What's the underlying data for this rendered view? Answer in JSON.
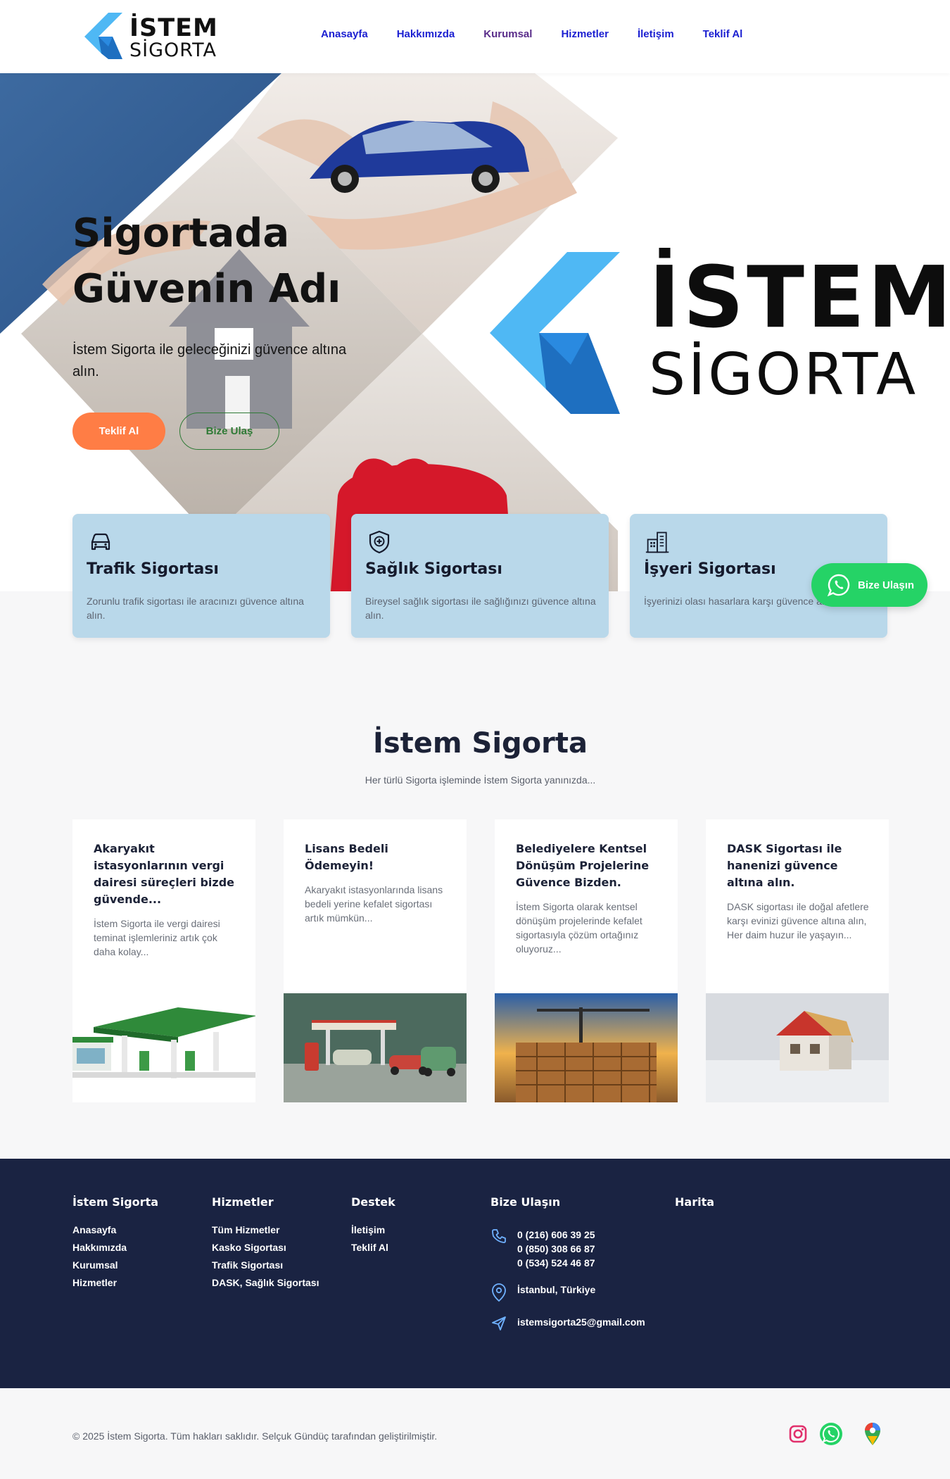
{
  "brand": {
    "name_line1": "İSTEM",
    "name_line2": "SİGORTA",
    "colors": {
      "accent_light": "#4fb8f4",
      "accent_dark": "#1e6fc0",
      "orange": "#ff7d45",
      "navy": "#1a2342",
      "card_blue": "#b9d8ea",
      "whatsapp": "#25d366"
    }
  },
  "nav": {
    "items": [
      {
        "label": "Anasayfa"
      },
      {
        "label": "Hakkımızda"
      },
      {
        "label": "Kurumsal"
      },
      {
        "label": "Hizmetler"
      },
      {
        "label": "İletişim"
      },
      {
        "label": "Teklif Al"
      }
    ]
  },
  "hero": {
    "title_line1": "Sigortada",
    "title_line2": "Güvenin Adı",
    "subtitle": "İstem Sigorta ile geleceğinizi güvence altına alın.",
    "primary_button": "Teklif Al",
    "secondary_button": "Bize Ulaş",
    "big_logo_line1": "İSTEM",
    "big_logo_line2": "SİGORTA"
  },
  "services": [
    {
      "icon": "car-icon",
      "title": "Trafik Sigortası",
      "desc": "Zorunlu trafik sigortası ile aracınızı güvence altına alın."
    },
    {
      "icon": "shield-health-icon",
      "title": "Sağlık Sigortası",
      "desc": "Bireysel sağlık sigortası ile sağlığınızı güvence altına alın."
    },
    {
      "icon": "building-icon",
      "title": "İşyeri Sigortası",
      "desc": "İşyerinizi olası hasarlara karşı güvence altına alın."
    }
  ],
  "whatsapp_float": {
    "label": "Bize Ulaşın",
    "icon": "whatsapp-icon"
  },
  "section": {
    "title": "İstem Sigorta",
    "subtitle": "Her türlü Sigorta işleminde İstem Sigorta yanınızda..."
  },
  "posts": [
    {
      "title": "Akaryakıt istasyonlarının vergi dairesi süreçleri bizde güvende...",
      "excerpt": "İstem Sigorta ile vergi dairesi teminat işlemleriniz artık çok daha kolay...",
      "image": "gas-station-illustration"
    },
    {
      "title": "Lisans Bedeli Ödemeyin!",
      "excerpt": "Akaryakıt istasyonlarında lisans bedeli yerine kefalet sigortası artık mümkün...",
      "image": "retro-gas-station-illustration"
    },
    {
      "title": "Belediyelere Kentsel Dönüşüm Projelerine Güvence Bizden.",
      "excerpt": "İstem Sigorta olarak kentsel dönüşüm projelerinde kefalet sigortasıyla çözüm ortağınız oluyoruz...",
      "image": "construction-site-photo"
    },
    {
      "title": "DASK Sigortası ile hanenizi güvence altına alın.",
      "excerpt": "DASK sigortası ile doğal afetlere karşı evinizi güvence altına alın, Her daim huzur ile yaşayın...",
      "image": "house-model-photo"
    }
  ],
  "footer": {
    "col1": {
      "title": "İstem Sigorta",
      "links": [
        "Anasayfa",
        "Hakkımızda",
        "Kurumsal",
        "Hizmetler"
      ]
    },
    "col2": {
      "title": "Hizmetler",
      "links": [
        "Tüm Hizmetler",
        "Kasko Sigortası",
        "Trafik Sigortası",
        "DASK, Sağlık Sigortası"
      ]
    },
    "col3": {
      "title": "Destek",
      "links": [
        "İletişim",
        "Teklif Al"
      ]
    },
    "col4": {
      "title": "Bize Ulaşın",
      "phones": [
        "0 (216) 606 39 25",
        "0 (850) 308 66 87",
        "0 (534) 524 46 87"
      ],
      "location": "İstanbul, Türkiye",
      "email": "istemsigorta25@gmail.com"
    },
    "col5": {
      "title": "Harita"
    }
  },
  "bottom": {
    "copyright": "© 2025 İstem Sigorta. Tüm hakları saklıdır. Selçuk Gündüç tarafından geliştirilmiştir.",
    "social": [
      "instagram-icon",
      "whatsapp-icon",
      "google-maps-icon"
    ]
  }
}
